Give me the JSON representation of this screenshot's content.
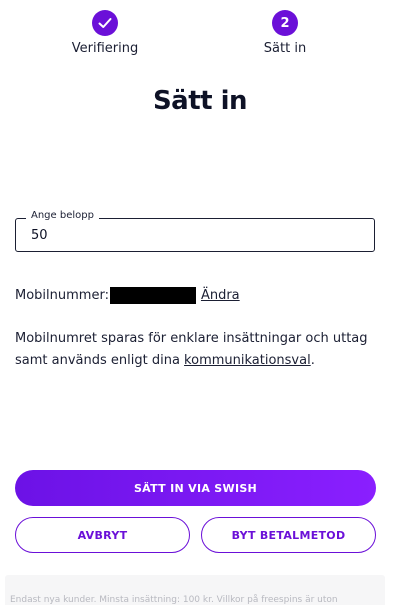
{
  "stepper": {
    "steps": [
      {
        "label": "Verifiering",
        "state": "completed",
        "icon": "checkmark-icon"
      },
      {
        "number": "2",
        "label": "Sätt in",
        "state": "active"
      }
    ]
  },
  "title": "Sätt in",
  "amount_field": {
    "label": "Ange belopp",
    "value": "50"
  },
  "phone": {
    "label": "Mobilnummer:",
    "change_link": "Ändra"
  },
  "info": {
    "text_before": "Mobilnumret sparas för enklare insättningar och uttag samt används enligt dina ",
    "link": "kommunikationsval",
    "text_after": "."
  },
  "buttons": {
    "primary": "SÄTT IN VIA SWISH",
    "cancel": "AVBRYT",
    "switch_method": "BYT BETALMETOD"
  },
  "footer": {
    "text": "Endast nya kunder. Minsta insättning: 100 kr. Villkor på freespins är uton"
  },
  "colors": {
    "accent": "#6b10d8",
    "text": "#0e1226"
  }
}
